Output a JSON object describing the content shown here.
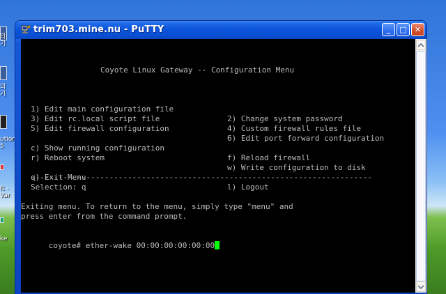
{
  "desktop": {
    "labels": [
      "의\n기",
      "의\n기",
      "ution\n5",
      "ft -\nVar",
      "ke"
    ]
  },
  "window": {
    "title": "trim703.mine.nu - PuTTY",
    "minimize_glyph": "_",
    "maximize_glyph": "□",
    "close_glyph": "✕"
  },
  "terminal": {
    "header": "Coyote Linux Gateway -- Configuration Menu",
    "menu_left": [
      "1) Edit main configuration file",
      "3) Edit rc.local script file",
      "5) Edit firewall configuration",
      "c) Show running configuration",
      "r) Reboot system",
      "q) Exit Menu"
    ],
    "menu_right": [
      "2) Change system password",
      "4) Custom firewall rules file",
      "6) Edit port forward configuration",
      "f) Reload firewall",
      "w) Write configuration to disk",
      "l) Logout"
    ],
    "separator": "--------------------------------------------------------------------------",
    "selection": "Selection: q",
    "exit_line_1": "Exiting menu. To return to the menu, simply type \"menu\" and",
    "exit_line_2": "press enter from the command prompt.",
    "prompt": "coyote# ether-wake 00:00:00:00:00:00"
  },
  "colors": {
    "terminal_bg": "#000000",
    "terminal_fg": "#bbbbbb",
    "cursor": "#00ff00",
    "titlebar": "#0a55dc"
  }
}
